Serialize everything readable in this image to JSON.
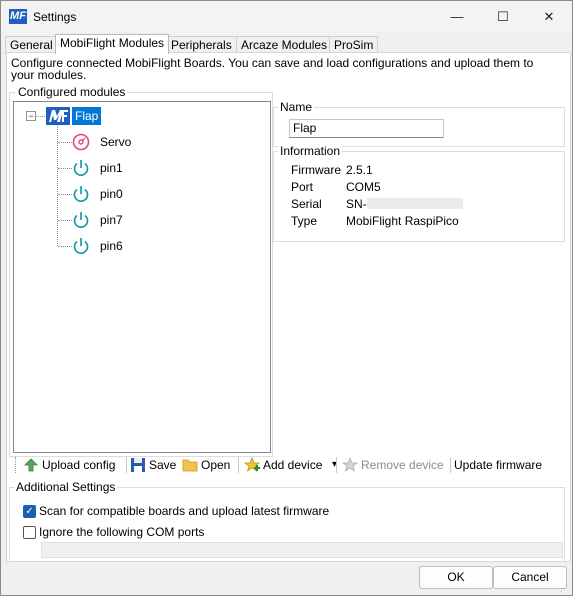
{
  "window": {
    "title": "Settings",
    "icon_text": "MF",
    "minimize": "—",
    "maximize": "☐",
    "close": "✕"
  },
  "tabs": [
    {
      "label": "General"
    },
    {
      "label": "MobiFlight Modules"
    },
    {
      "label": "Peripherals"
    },
    {
      "label": "Arcaze Modules"
    },
    {
      "label": "ProSim"
    }
  ],
  "description": "Configure connected MobiFlight Boards. You can save and load configurations and upload them to your modules.",
  "configured_modules": {
    "legend": "Configured modules",
    "expander": "−",
    "root": {
      "label": "Flap",
      "logo_text": "MF"
    },
    "children": [
      {
        "label": "Servo",
        "icon": "servo-icon"
      },
      {
        "label": "pin1",
        "icon": "power-icon"
      },
      {
        "label": "pin0",
        "icon": "power-icon"
      },
      {
        "label": "pin7",
        "icon": "power-icon"
      },
      {
        "label": "pin6",
        "icon": "power-icon"
      }
    ]
  },
  "name_group": {
    "legend": "Name",
    "value": "Flap"
  },
  "information": {
    "legend": "Information",
    "rows": [
      {
        "label": "Firmware",
        "value": "2.5.1"
      },
      {
        "label": "Port",
        "value": "COM5"
      },
      {
        "label": "Serial",
        "value": "SN-"
      },
      {
        "label": "Type",
        "value": "MobiFlight RaspiPico"
      }
    ]
  },
  "toolbar": {
    "upload_config": "Upload config",
    "save": "Save",
    "open": "Open",
    "add_device": "Add device",
    "add_device_arrow": "▾",
    "remove_device": "Remove device",
    "update_firmware": "Update firmware"
  },
  "additional_settings": {
    "legend": "Additional Settings",
    "scan_label": "Scan for compatible boards and upload latest firmware",
    "scan_checked": true,
    "ignore_label": "Ignore the following COM ports",
    "ignore_checked": false
  },
  "footer": {
    "ok": "OK",
    "cancel": "Cancel"
  },
  "colors": {
    "accent": "#1a5fb4",
    "selection": "#0078d7",
    "servo": "#e0457b",
    "pin": "#1a9aa8"
  }
}
